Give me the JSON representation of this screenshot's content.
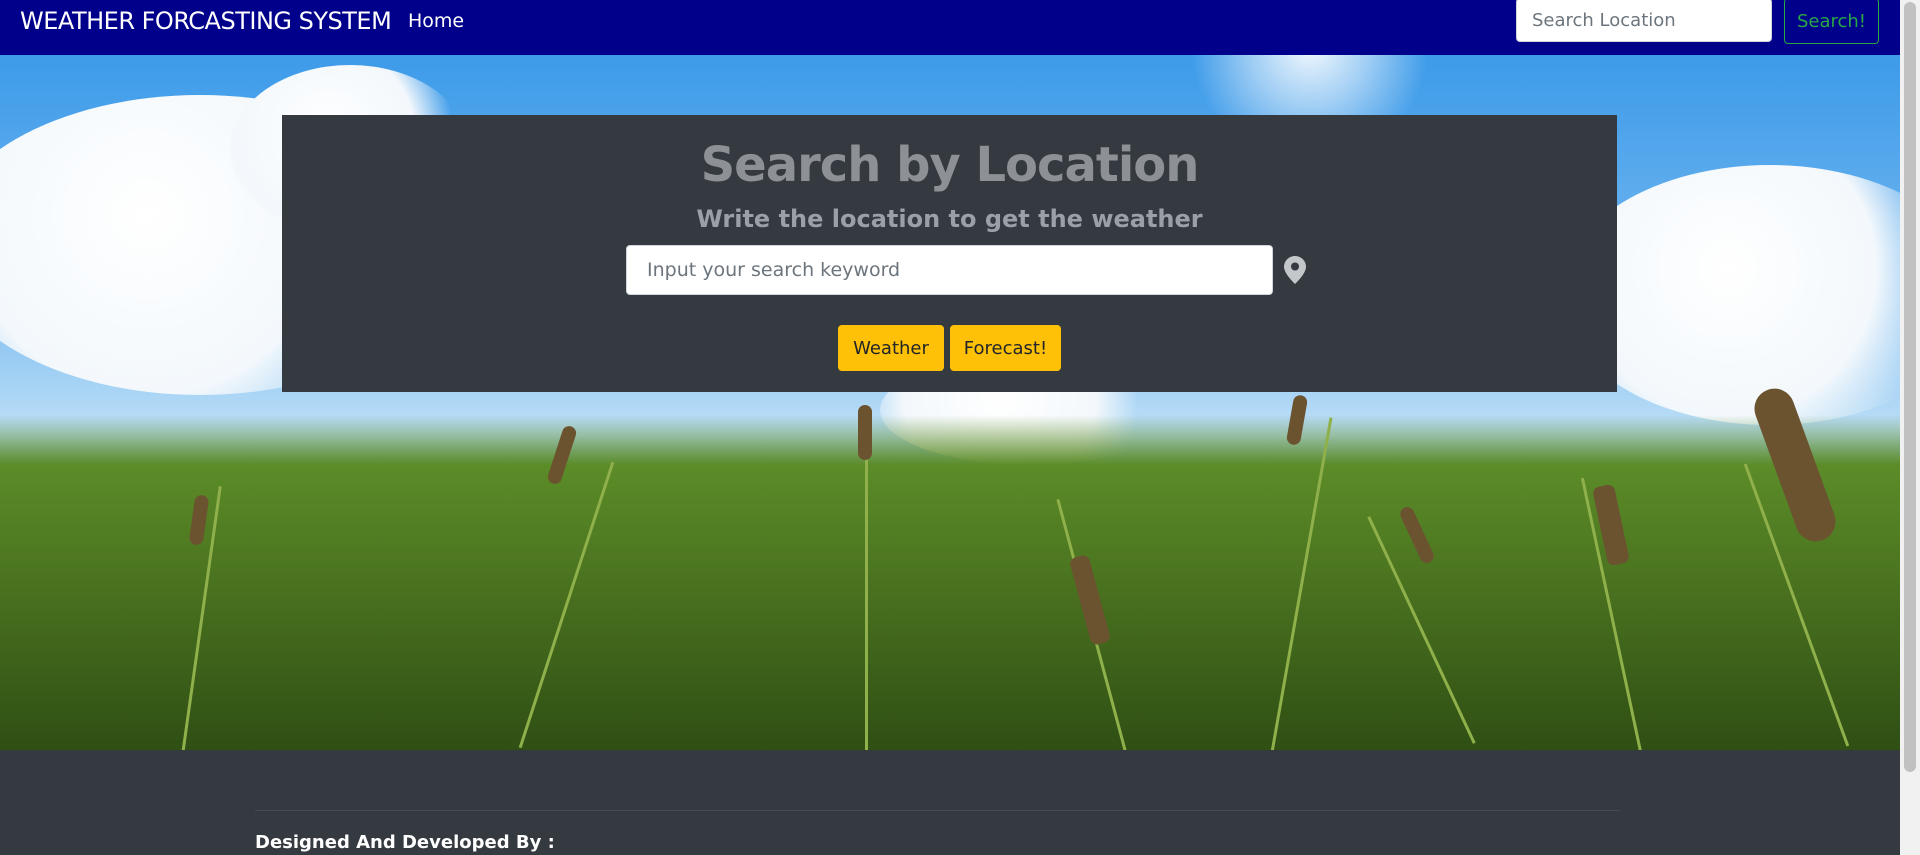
{
  "navbar": {
    "brand": "WEATHER FORCASTING SYSTEM",
    "home_label": "Home",
    "search_placeholder": "Search Location",
    "search_button": "Search!"
  },
  "hero": {
    "title": "Search by Location",
    "subtitle": "Write the location to get the weather",
    "search_placeholder": "Input your search keyword",
    "location_icon": "map-pin-icon",
    "weather_button": "Weather",
    "forecast_button": "Forecast!"
  },
  "footer": {
    "credit_label": "Designed And Developed By :"
  },
  "colors": {
    "navbar_bg": "#00008b",
    "panel_bg": "#343a40",
    "accent_yellow": "#ffc107",
    "search_button_green": "#28a745"
  }
}
